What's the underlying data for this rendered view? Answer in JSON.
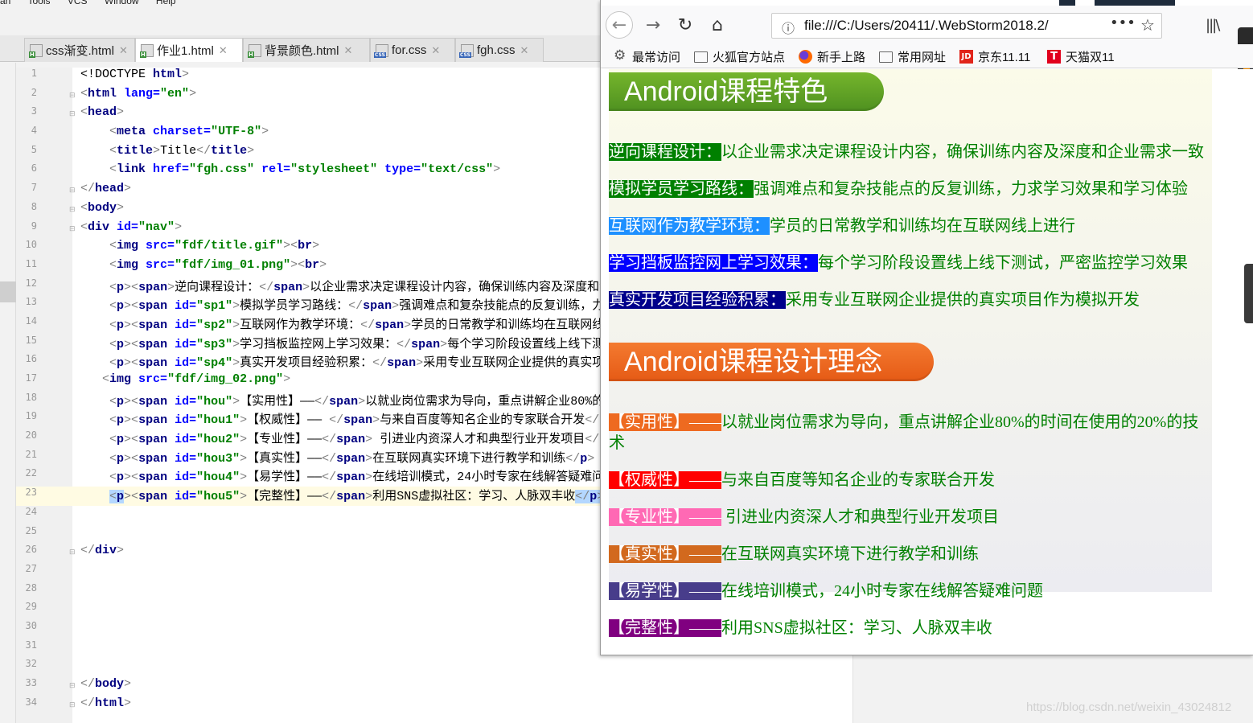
{
  "ide": {
    "menu": [
      "an",
      "Tools",
      "VCS",
      "Window",
      "Help"
    ],
    "tabs": [
      {
        "label": "css渐变.html",
        "type": "html"
      },
      {
        "label": "作业1.html",
        "type": "html"
      },
      {
        "label": "背景颜色.html",
        "type": "html"
      },
      {
        "label": "for.css",
        "type": "css"
      },
      {
        "label": "fgh.css",
        "type": "css"
      }
    ],
    "active_tab": 1,
    "current_line": 23,
    "line_numbers": [
      "1",
      "2",
      "3",
      "4",
      "5",
      "6",
      "7",
      "8",
      "9",
      "10",
      "11",
      "12",
      "13",
      "14",
      "15",
      "16",
      "17",
      "18",
      "19",
      "20",
      "21",
      "22",
      "23",
      "24",
      "25",
      "26",
      "27",
      "28",
      "29",
      "30",
      "31",
      "32",
      "33",
      "34"
    ]
  },
  "browser": {
    "url": "file:///C:/Users/20411/.WebStorm2018.2/",
    "bookmarks": [
      "最常访问",
      "火狐官方站点",
      "新手上路",
      "常用网址",
      "京东11.11",
      "天猫双11"
    ],
    "jd_logo": "JD",
    "tmall_logo": "T",
    "section1_title": "Android课程特色",
    "section2_title": "Android课程设计理念",
    "features": [
      {
        "label": "逆向课程设计：",
        "text": "以企业需求决定课程设计内容，确保训练内容及深度和企业需求一致",
        "color": "#008000"
      },
      {
        "label": "模拟学员学习路线：",
        "text": "强调难点和复杂技能点的反复训练，力求学习效果和学习体验",
        "color": "#008000"
      },
      {
        "label": "互联网作为教学环境：",
        "text": "学员的日常教学和训练均在互联网线上进行",
        "color": "#1e90ff"
      },
      {
        "label": "学习挡板监控网上学习效果：",
        "text": "每个学习阶段设置线上线下测试，严密监控学习效果",
        "color": "#0000ff"
      },
      {
        "label": "真实开发项目经验积累：",
        "text": "采用专业互联网企业提供的真实项目作为模拟开发",
        "color": "#00008b"
      }
    ],
    "ideas": [
      {
        "label": "【实用性】——",
        "text": "以就业岗位需求为导向，重点讲解企业80%的时间在使用的20%的技术",
        "color": "#ee6a20"
      },
      {
        "label": "【权威性】——",
        "text": "与来自百度等知名企业的专家联合开发",
        "color": "#ff0000"
      },
      {
        "label": "【专业性】——",
        "text": " 引进业内资深人才和典型行业开发项目",
        "color": "#ff69b4"
      },
      {
        "label": "【真实性】——",
        "text": "在互联网真实环境下进行教学和训练",
        "color": "#d2691e"
      },
      {
        "label": "【易学性】——",
        "text": "在线培训模式，24小时专家在线解答疑难问题",
        "color": "#483d8b"
      },
      {
        "label": "【完整性】——",
        "text": "利用SNS虚拟社区：学习、人脉双丰收",
        "color": "#800080"
      }
    ]
  },
  "watermark": "https://blog.csdn.net/weixin_43024812"
}
